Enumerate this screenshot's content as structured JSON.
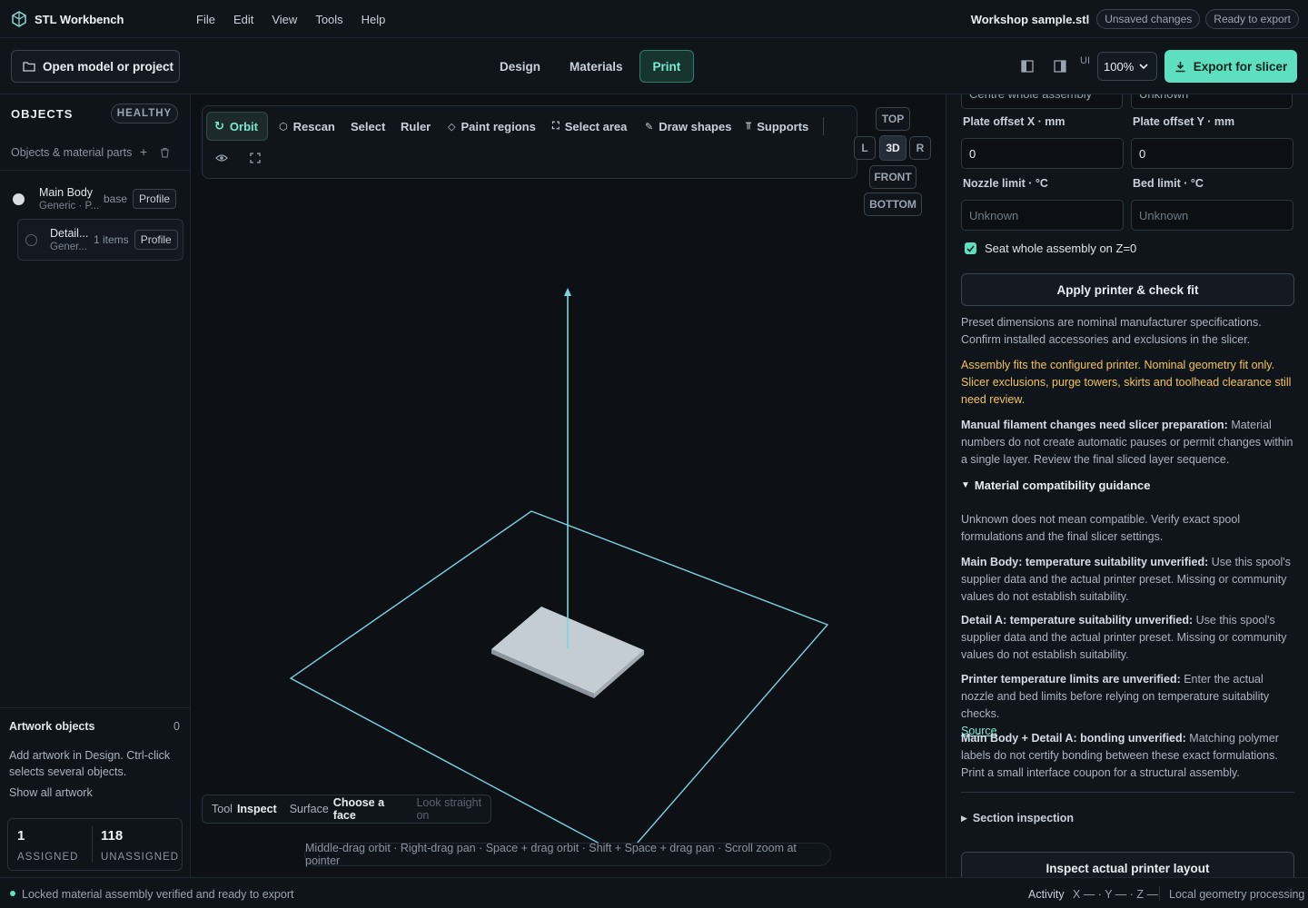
{
  "app": {
    "title": "STL Workbench"
  },
  "menu": [
    "File",
    "Edit",
    "View",
    "Tools",
    "Help"
  ],
  "header": {
    "filename": "Workshop sample.stl",
    "unsaved": "Unsaved changes",
    "ready": "Ready to export"
  },
  "toolbar": {
    "open_label": "Open model or project",
    "tabs": [
      "Design",
      "Materials",
      "Print"
    ],
    "active_tab": "Print",
    "ui_label": "UI",
    "zoom": "100%",
    "export_label": "Export for slicer"
  },
  "left": {
    "heading": "OBJECTS",
    "health": "HEALTHY",
    "subheading": "Objects & material parts",
    "objects": [
      {
        "name": "Main Body",
        "sub": "Generic · P...",
        "tag": "base",
        "button": "Profile",
        "color": "#d9dde2"
      },
      {
        "name": "Detail...",
        "sub": "Gener...",
        "tag": "1 items",
        "button": "Profile",
        "color": "transparent"
      }
    ],
    "artwork_heading": "Artwork objects",
    "artwork_count": "0",
    "artwork_hint": "Add artwork in Design. Ctrl-click selects several objects.",
    "show_all": "Show all artwork",
    "assigned_value": "1",
    "assigned_label": "ASSIGNED",
    "unassigned_value": "118",
    "unassigned_label": "UNASSIGNED"
  },
  "viewport": {
    "tools": [
      "Orbit",
      "Rescan",
      "Select",
      "Ruler",
      "Paint regions",
      "Select area",
      "Draw shapes",
      "Supports"
    ],
    "views": {
      "top": "TOP",
      "left": "L",
      "three_d": "3D",
      "right": "R",
      "front": "FRONT",
      "bottom": "BOTTOM"
    },
    "status_tool_label": "Tool",
    "status_tool_value": "Inspect",
    "status_surface_label": "Surface",
    "status_surface_value": "Choose a face",
    "status_look": "Look straight on",
    "hint": "Middle-drag orbit · Right-drag pan · Space + drag orbit · Shift + Space + drag pan · Scroll zoom at pointer",
    "accent": "#7fd3dd",
    "model_color": "#c4ccd4"
  },
  "right": {
    "cut_top_left": "Centre whole assembly",
    "cut_top_right": "Unknown",
    "plate_x_label": "Plate offset X · mm",
    "plate_y_label": "Plate offset Y · mm",
    "plate_x": "0",
    "plate_y": "0",
    "nozzle_label": "Nozzle limit · °C",
    "bed_label": "Bed limit · °C",
    "nozzle_placeholder": "Unknown",
    "bed_placeholder": "Unknown",
    "seat_label": "Seat whole assembly on Z=0",
    "apply_btn": "Apply printer & check fit",
    "preset_note": "Preset dimensions are nominal manufacturer specifications. Confirm installed accessories and exclusions in the slicer.",
    "fit_warning": "Assembly fits the configured printer. Nominal geometry fit only. Slicer exclusions, purge towers, skirts and toolhead clearance still need review.",
    "manual_bold": "Manual filament changes need slicer preparation:",
    "manual_text": " Material numbers do not create automatic pauses or permit changes within a single layer. Review the final sliced layer sequence.",
    "compat_heading": "Material compatibility guidance",
    "compat_intro": "Unknown does not mean compatible. Verify exact spool formulations and the final slicer settings.",
    "main_bold": "Main Body: temperature suitability unverified:",
    "main_text": " Use this spool's supplier data and the actual printer preset. Missing or community values do not establish suitability.",
    "detail_bold": "Detail A: temperature suitability unverified:",
    "detail_text": " Use this spool's supplier data and the actual printer preset. Missing or community values do not establish suitability.",
    "printer_bold": "Printer temperature limits are unverified:",
    "printer_text": " Enter the actual nozzle and bed limits before relying on temperature suitability checks.",
    "source_link": "Source",
    "bond_bold": "Main Body + Detail A: bonding unverified:",
    "bond_text": " Matching polymer labels do not certify bonding between these exact formulations. Print a small interface coupon for a structural assembly.",
    "section_inspection": "Section inspection",
    "inspect_btn": "Inspect actual printer layout"
  },
  "status": {
    "message": "Locked material assembly verified and ready to export",
    "activity": "Activity",
    "coords": "X — · Y — · Z —",
    "local": "Local geometry processing"
  }
}
